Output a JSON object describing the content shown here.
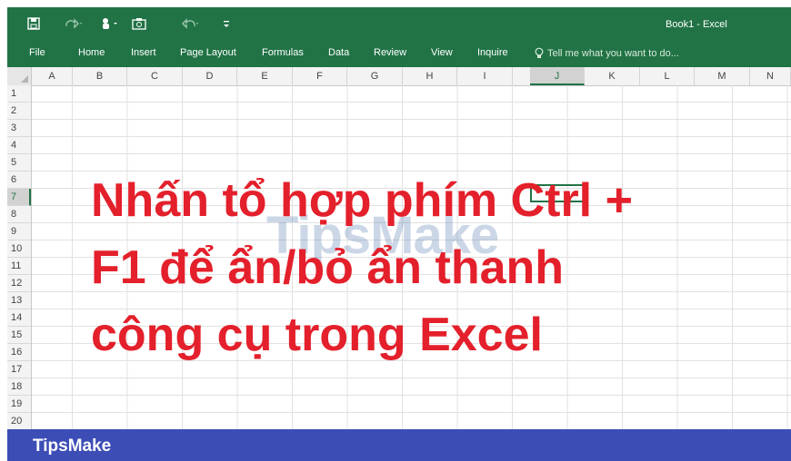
{
  "window": {
    "title": "Book1 - Excel"
  },
  "quick_access": [
    {
      "icon": "save-icon"
    },
    {
      "icon": "redo-icon"
    },
    {
      "icon": "touch-mode-icon"
    },
    {
      "icon": "camera-icon"
    },
    {
      "icon": "undo-icon"
    },
    {
      "icon": "customize-icon"
    }
  ],
  "ribbon": {
    "tabs": [
      "File",
      "Home",
      "Insert",
      "Page Layout",
      "Formulas",
      "Data",
      "Review",
      "View",
      "Inquire"
    ],
    "tell_me": "Tell me what you want to do..."
  },
  "sheet": {
    "columns": [
      "A",
      "B",
      "C",
      "D",
      "E",
      "F",
      "G",
      "H",
      "I",
      "J",
      "K",
      "L",
      "M",
      "N"
    ],
    "rows": [
      "1",
      "2",
      "3",
      "4",
      "5",
      "6",
      "7",
      "8",
      "9",
      "10",
      "11",
      "12",
      "13",
      "14",
      "15",
      "16",
      "17",
      "18",
      "19",
      "20"
    ],
    "selected_column": "J",
    "selected_row": "7"
  },
  "overlay": {
    "lines": [
      "Nhấn tổ hợp phím Ctrl +",
      "F1 để ẩn/bỏ ẩn thanh",
      "công cụ trong Excel"
    ],
    "watermark": "TipsMake"
  },
  "brand": {
    "name": "TipsMake"
  },
  "colors": {
    "excel_green": "#217346",
    "overlay_red": "#e3202b",
    "brand_blue": "#3d4db6"
  }
}
